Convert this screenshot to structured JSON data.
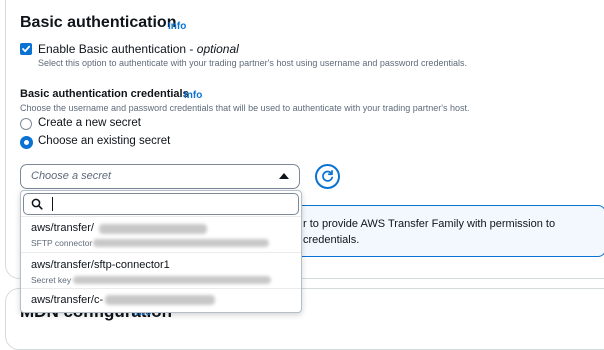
{
  "section": {
    "title": "Basic authentication",
    "info": "Info",
    "checkbox_label": "Enable Basic authentication - ",
    "checkbox_optional": "optional",
    "checkbox_desc": "Select this option to authenticate with your trading partner's host using username and password credentials."
  },
  "credentials": {
    "title": "Basic authentication credentials",
    "info": "Info",
    "desc": "Choose the username and password credentials that will be used to authenticate with your trading partner's host.",
    "options": [
      {
        "label": "Create a new secret",
        "selected": false
      },
      {
        "label": "Choose an existing secret",
        "selected": true
      }
    ]
  },
  "select": {
    "placeholder": "Choose a secret"
  },
  "alert": {
    "text": "r to provide AWS Transfer Family with permission to credentials."
  },
  "dropdown": {
    "items": [
      {
        "label": "aws/transfer/",
        "sub": "SFTP connector"
      },
      {
        "label": "aws/transfer/sftp-connector1",
        "sub": "Secret key"
      },
      {
        "label": "aws/transfer/c-",
        "sub": ""
      }
    ]
  },
  "next_section": {
    "title": "MDN configuration",
    "info": "Info"
  },
  "colors": {
    "accent": "#0972d3",
    "text": "#0f141a",
    "muted": "#5f6b7a"
  }
}
